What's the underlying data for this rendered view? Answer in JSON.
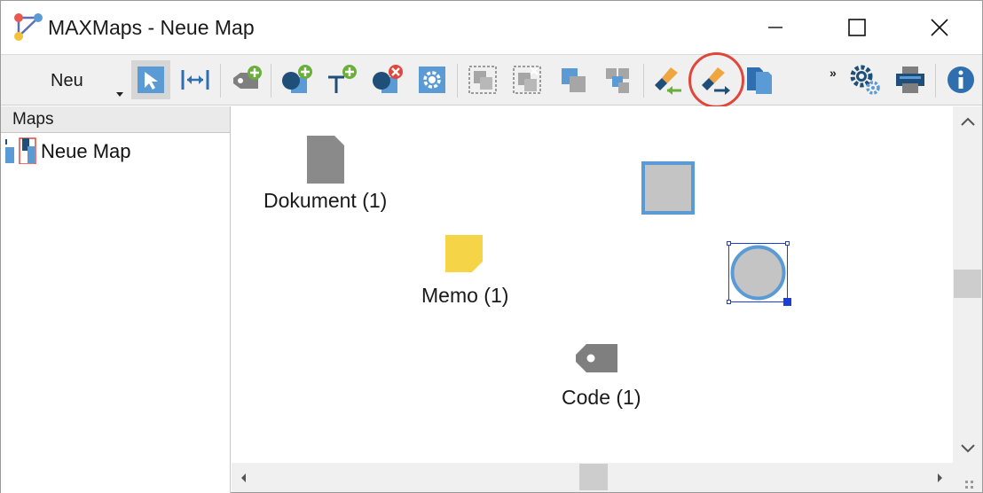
{
  "window": {
    "title": "MAXMaps - Neue Map"
  },
  "toolbar": {
    "new_label": "Neu",
    "overflow_label": "»",
    "icons": [
      "select-pointer-icon",
      "fit-width-icon",
      "add-code-icon",
      "add-shape-icon",
      "add-text-icon",
      "remove-shape-icon",
      "settings-icon",
      "group-icon",
      "ungroup-icon",
      "bring-front-icon",
      "send-back-icon",
      "format-painter-import-icon",
      "format-painter-export-icon",
      "copy-map-icon",
      "options-gears-icon",
      "print-icon",
      "info-icon"
    ],
    "highlight_color": "#e0463a"
  },
  "left_panel": {
    "header": "Maps",
    "items": [
      {
        "label": "Neue Map"
      }
    ]
  },
  "canvas": {
    "nodes": [
      {
        "label": "Dokument (1)",
        "icon": "document-icon"
      },
      {
        "label": "Memo (1)",
        "icon": "memo-icon"
      },
      {
        "label": "Code (1)",
        "icon": "code-tag-icon"
      },
      {
        "label": "",
        "icon": "square-shape-icon"
      },
      {
        "label": "",
        "icon": "circle-shape-icon"
      }
    ]
  },
  "colors": {
    "accent_blue": "#5b9bd5",
    "memo_yellow": "#f5d547",
    "shape_fill": "#c4c4c4",
    "selection": "#1a3fd6"
  }
}
